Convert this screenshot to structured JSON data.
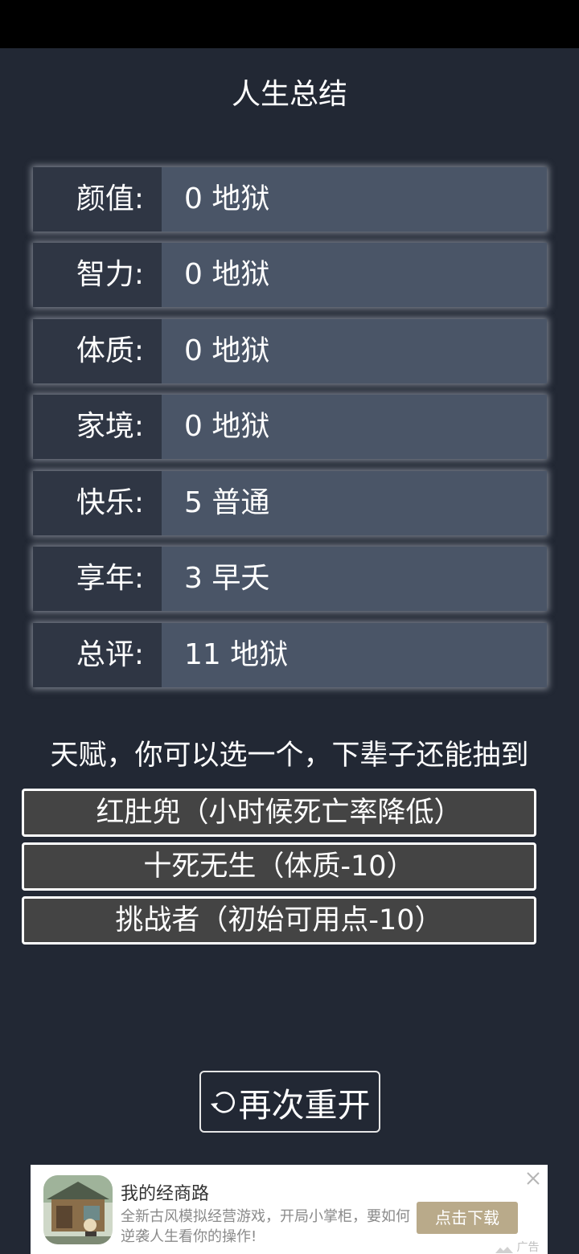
{
  "header": {
    "title": "人生总结"
  },
  "stats": [
    {
      "label": "颜值:",
      "value": "0 地狱"
    },
    {
      "label": "智力:",
      "value": "0 地狱"
    },
    {
      "label": "体质:",
      "value": "0 地狱"
    },
    {
      "label": "家境:",
      "value": "0 地狱"
    },
    {
      "label": "快乐:",
      "value": "5 普通"
    },
    {
      "label": "享年:",
      "value": "3 早夭"
    },
    {
      "label": "总评:",
      "value": "11 地狱"
    }
  ],
  "talents": {
    "heading": "天赋，你可以选一个，下辈子还能抽到",
    "options": [
      "红肚兜（小时候死亡率降低）",
      "十死无生（体质-10）",
      "挑战者（初始可用点-10）"
    ]
  },
  "restart_button": {
    "label": "再次重开",
    "icon": "refresh-icon"
  },
  "ad": {
    "title": "我的经商路",
    "description": "全新古风模拟经营游戏，开局小掌柜，要如何逆袭人生看你的操作!",
    "button_label": "点击下载",
    "tag": "广告",
    "close_icon": "close-icon"
  },
  "colors": {
    "background": "#222834",
    "label_cell": "#2f3644",
    "value_cell": "#4a5567",
    "talent_button": "#444444",
    "ad_button": "#b9aa8a"
  }
}
